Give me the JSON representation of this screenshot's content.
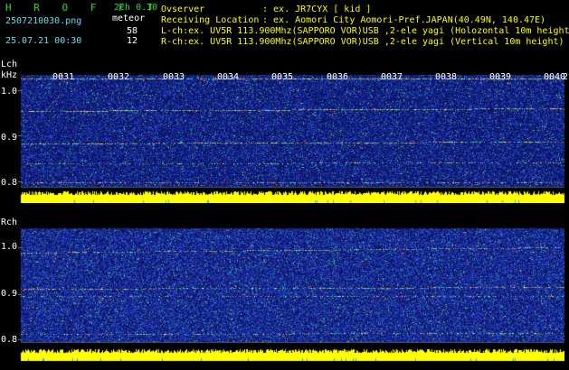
{
  "header": {
    "brand": "H R O F F T",
    "mode": "2ch 0.30",
    "filename": "2507210030.png",
    "meteor_label": "meteor",
    "datetime": "25.07.21 00:30",
    "count_l": "58",
    "count_r": "12",
    "observer_label": "Ovserver",
    "observer_value": ": ex. JR7CYX [ kid ]",
    "location_label": "Receiving Location",
    "location_value": ": ex. Aomori City Aomori-Pref.JAPAN(40.49N, 140.47E)",
    "lch_info": "L-ch:ex. UV5R 113.900Mhz(SAPPORO VOR)USB ,2-ele yagi (Holozontal 10m height)",
    "rch_info": "R-ch:ex. UV5R 113.900Mhz(SAPPORO VOR)USB ,2-ele yagi (Vertical 10m height)"
  },
  "lch_panel": {
    "label": "Lch",
    "unit": "kHz",
    "ticks": [
      "1.0",
      "0.9",
      "0.8"
    ]
  },
  "rch_panel": {
    "label": "Rch",
    "ticks": [
      "1.0",
      "0.9",
      "0.8"
    ]
  },
  "time_labels": [
    "0031",
    "0032",
    "0033",
    "0034",
    "0035",
    "0036",
    "0037",
    "0038",
    "0039",
    "0040",
    "2"
  ],
  "colors": {
    "background": "#000000",
    "spectrum_blue": "#1c2c9c",
    "power_bar": "#ffff00",
    "text_green": "#39d339",
    "text_cyan": "#66ddee"
  }
}
